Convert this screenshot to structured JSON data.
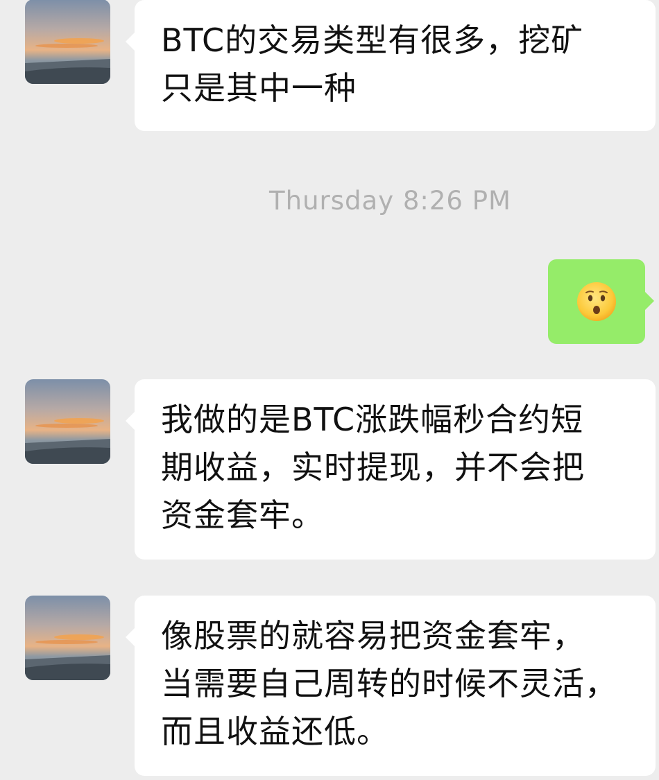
{
  "conversation": {
    "messages": [
      {
        "sender": "contact",
        "lines": [
          "BTC的交易类型有很多，挖矿",
          "只是其中一种"
        ]
      },
      {
        "type": "timestamp",
        "text": "Thursday 8:26 PM"
      },
      {
        "sender": "me",
        "emoji": "hushed-face"
      },
      {
        "sender": "contact",
        "lines": [
          "我做的是BTC涨跌幅秒合约短",
          "期收益，实时提现，并不会把",
          "资金套牢。"
        ]
      },
      {
        "sender": "contact",
        "lines": [
          "像股票的就容易把资金套牢，",
          "当需要自己周转的时候不灵活，",
          "而且收益还低。"
        ]
      }
    ]
  },
  "colors": {
    "background": "#ededed",
    "incoming_bubble": "#ffffff",
    "outgoing_bubble": "#95ec69",
    "timestamp_text": "#b0b0b0",
    "message_text": "#111111"
  },
  "icons": {
    "contact_avatar": "sunset-beach-avatar",
    "sent_emoji": "hushed-face-emoji"
  }
}
